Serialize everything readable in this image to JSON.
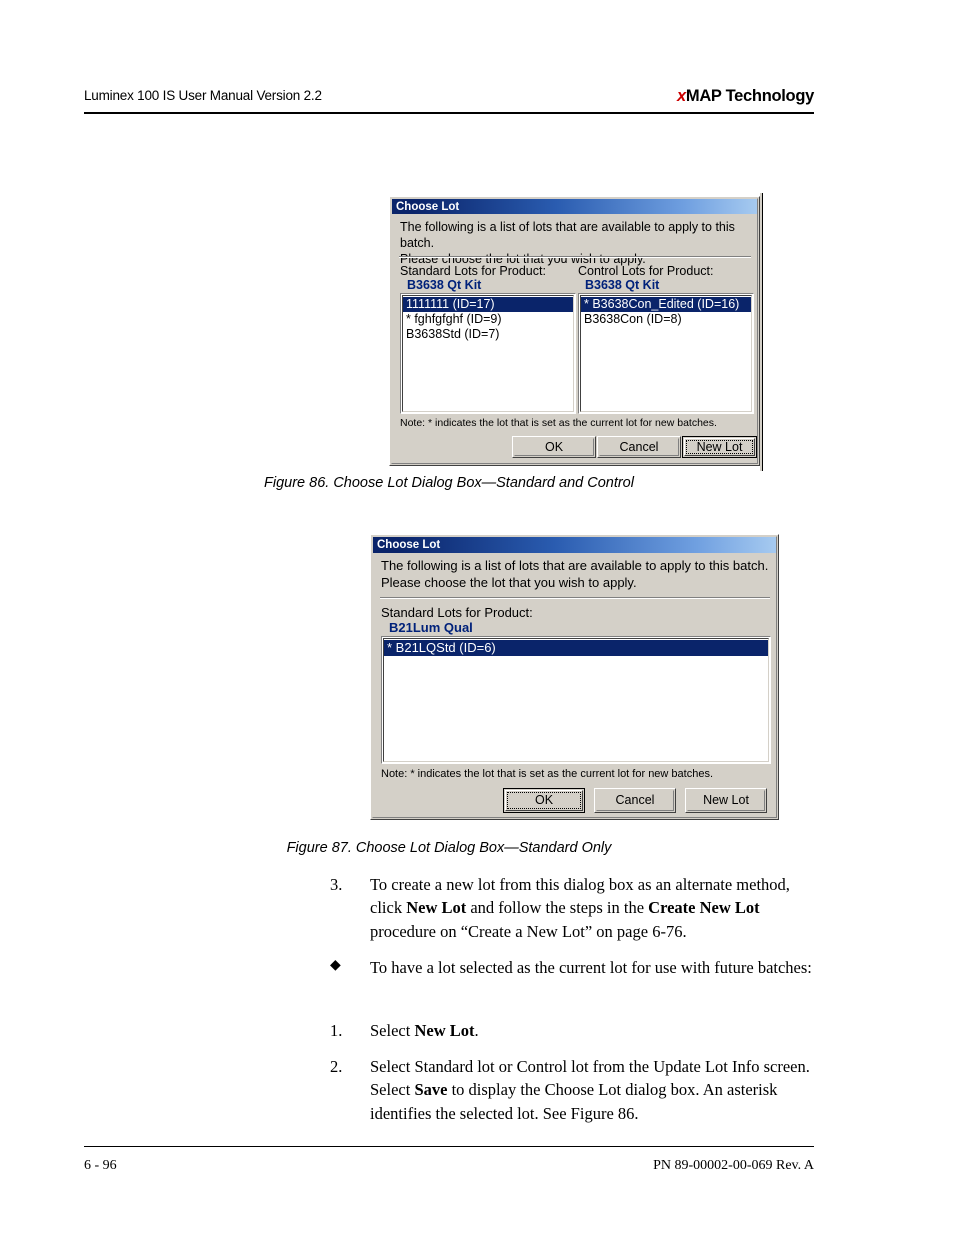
{
  "header": {
    "left": "Luminex 100 IS User Manual Version 2.2",
    "brand_x": "x",
    "brand_rest": "MAP Technology"
  },
  "figure86": {
    "caption": "Figure 86.  Choose Lot Dialog Box—Standard and Control",
    "dialog": {
      "title": "Choose Lot",
      "intro": "The following is a list of lots that are available to apply to this batch.\nPlease choose the lot that you wish to apply.",
      "standard_label": "Standard Lots for Product:",
      "standard_product": "B3638 Qt Kit",
      "standard_items": [
        {
          "text": "1111111 (ID=17)",
          "selected": true
        },
        {
          "text": "* fghfgfghf (ID=9)",
          "selected": false
        },
        {
          "text": "B3638Std (ID=7)",
          "selected": false
        }
      ],
      "control_label": "Control Lots for Product:",
      "control_product": "B3638 Qt Kit",
      "control_items": [
        {
          "text": "* B3638Con_Edited (ID=16)",
          "selected": true
        },
        {
          "text": "B3638Con (ID=8)",
          "selected": false
        }
      ],
      "note": "Note: * indicates the lot that is set as the current lot for new batches.",
      "buttons": {
        "ok": "OK",
        "cancel": "Cancel",
        "new_lot": "New Lot"
      },
      "focused_button": "New Lot"
    }
  },
  "figure87": {
    "caption": "Figure 87.  Choose Lot Dialog Box—Standard Only",
    "dialog": {
      "title": "Choose Lot",
      "intro": "The following is a list of lots that are available to apply to this batch.\nPlease choose the lot that you wish to apply.",
      "standard_label": "Standard Lots for Product:",
      "standard_product": "B21Lum Qual",
      "standard_items": [
        {
          "text": "* B21LQStd (ID=6)",
          "selected": true
        }
      ],
      "note": "Note: * indicates the lot that is set as the current lot for new batches.",
      "buttons": {
        "ok": "OK",
        "cancel": "Cancel",
        "new_lot": "New Lot"
      },
      "focused_button": "OK"
    }
  },
  "body": {
    "step3_marker": "3.",
    "step3_part1": "To create a new lot from this dialog box as an alternate method, click ",
    "step3_bold1": "New Lot",
    "step3_part2": " and follow the steps in the ",
    "step3_bold2": "Create New Lot",
    "step3_part3": " procedure on “Create a New Lot” on page 6-76.",
    "bullet_marker": "◆",
    "bullet_text": "To have a lot selected as the current lot for use with future batches:",
    "step1_marker": "1.",
    "step1_part1": "Select ",
    "step1_bold1": "New Lot",
    "step1_part2": ".",
    "step2_marker": "2.",
    "step2_part1": "Select Standard lot or Control lot from the Update Lot Info screen. Select ",
    "step2_bold1": "Save",
    "step2_part2": " to display the Choose Lot dialog box. An asterisk identifies the selected lot. See Figure 86."
  },
  "footer": {
    "page_number": "6 - 96",
    "part_number": "PN 89-00002-00-069 Rev. A"
  }
}
